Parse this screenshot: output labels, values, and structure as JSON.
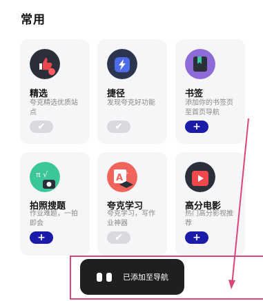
{
  "section_title": "常用",
  "cards": [
    {
      "title": "精选",
      "desc": "夸克精选优质站点",
      "state": "added",
      "icon": "thumbs-up-icon"
    },
    {
      "title": "捷径",
      "desc": "发现夸克好功能",
      "state": "added",
      "icon": "lightning-icon"
    },
    {
      "title": "书签",
      "desc": "添加你的书签页至首页导航",
      "state": "add",
      "icon": "bookmark-icon"
    },
    {
      "title": "拍照搜题",
      "desc": "作业难题，一拍即会",
      "state": "add",
      "icon": "camera-math-icon"
    },
    {
      "title": "夸克学习",
      "desc": "夸克学习，写作业神器",
      "state": "added",
      "icon": "graduation-icon"
    },
    {
      "title": "高分电影",
      "desc": "热门高分影视推荐",
      "state": "add",
      "icon": "play-icon"
    }
  ],
  "buttons": {
    "added_symbol": "✔",
    "add_symbol": "+"
  },
  "toast": {
    "text": "已添加至导航"
  },
  "colors": {
    "accent": "#1c1aa8",
    "annotation": "#d9457a"
  }
}
